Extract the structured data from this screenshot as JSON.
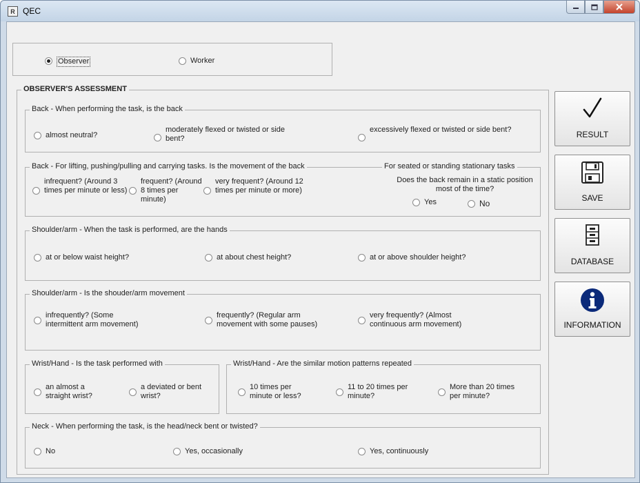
{
  "window": {
    "title": "QEC",
    "app_icon_glyph": "R"
  },
  "mode": {
    "observer": "Observer",
    "worker": "Worker",
    "selected": "observer"
  },
  "assessment": {
    "title": "OBSERVER'S ASSESSMENT",
    "back_posture": {
      "legend": "Back - When performing the task, is the back",
      "options": [
        "almost neutral?",
        "moderately flexed or twisted or side bent?",
        "excessively flexed or twisted or side bent?"
      ]
    },
    "back_movement": {
      "legend": "Back - For lifting, pushing/pulling and carrying tasks. Is the movement of the back",
      "options": [
        "infrequent? (Around 3 times per minute or less)",
        "frequent? (Around 8 times per minute)",
        "very frequent? (Around 12 times per minute or more)"
      ]
    },
    "static": {
      "legend": "For seated or standing stationary tasks",
      "question": "Does the back remain in a static position most of the time?",
      "yes": "Yes",
      "no": "No"
    },
    "shoulder_height": {
      "legend": "Shoulder/arm - When the task is performed, are the hands",
      "options": [
        "at or below waist height?",
        "at about chest height?",
        "at or above shoulder height?"
      ]
    },
    "shoulder_movement": {
      "legend": "Shoulder/arm - Is the shouder/arm movement",
      "options": [
        "infrequently? (Some intermittent arm movement)",
        "frequently? (Regular arm movement with some pauses)",
        "very frequently? (Almost continuous arm movement)"
      ]
    },
    "wrist_posture": {
      "legend": "Wrist/Hand - Is the task performed with",
      "options": [
        "an almost a straight wrist?",
        "a deviated or bent wrist?"
      ]
    },
    "wrist_repetition": {
      "legend": "Wrist/Hand - Are the similar motion patterns repeated",
      "options": [
        "10 times per minute or less?",
        "11 to 20 times per minute?",
        "More than 20 times per minute?"
      ]
    },
    "neck": {
      "legend": "Neck - When performing the task, is the head/neck bent or twisted?",
      "options": [
        "No",
        "Yes, occasionally",
        "Yes, continuously"
      ]
    }
  },
  "buttons": {
    "result": {
      "label": "RESULT",
      "icon": "checkmark-icon"
    },
    "save": {
      "label": "SAVE",
      "icon": "floppy-disk-icon"
    },
    "database": {
      "label": "DATABASE",
      "icon": "file-cabinet-icon"
    },
    "information": {
      "label": "INFORMATION",
      "icon": "info-icon"
    }
  }
}
